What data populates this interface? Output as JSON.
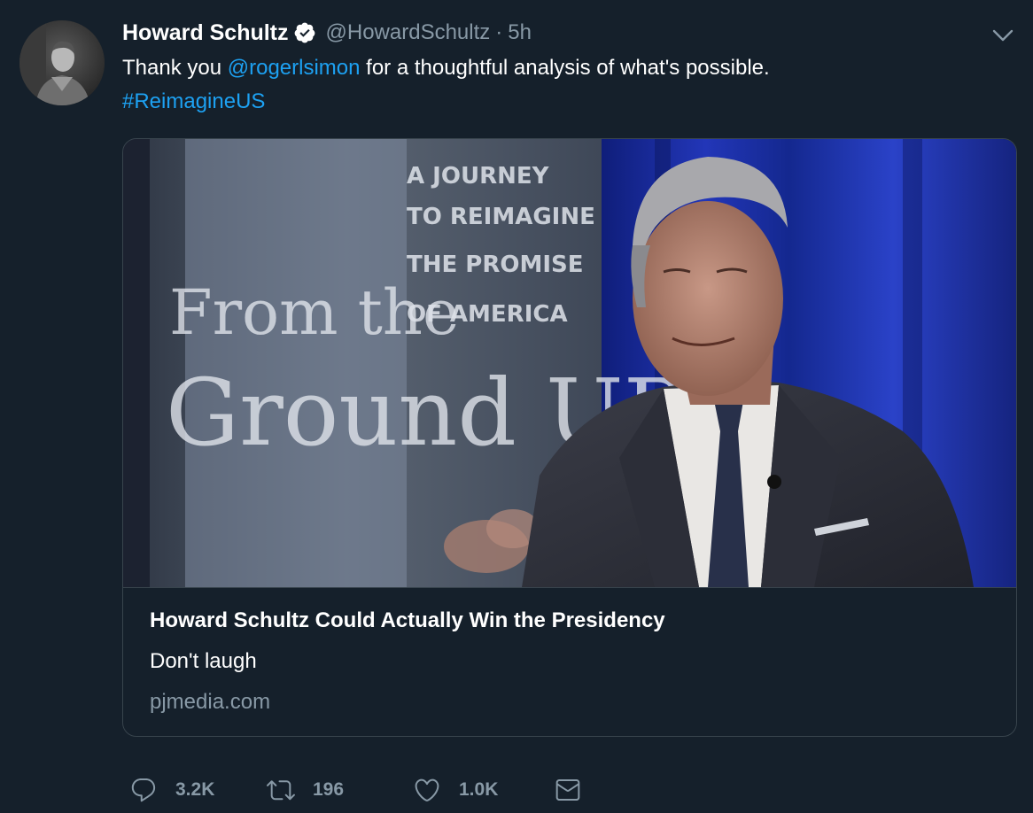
{
  "tweet": {
    "author": {
      "display_name": "Howard Schultz",
      "handle": "@HowardSchultz",
      "verified": true
    },
    "separator": "·",
    "time": "5h",
    "text_prefix": "Thank you ",
    "mention": "@rogerlsimon",
    "text_suffix": " for a thoughtful analysis of what's possible.",
    "hashtag": "#ReimagineUS"
  },
  "card": {
    "image_text": {
      "from_the": "From the",
      "ground_up": "Ground UP",
      "journey_lines": [
        "A JOURNEY",
        "TO REIMAGINE",
        "THE PROMISE",
        "OF AMERICA"
      ]
    },
    "title": "Howard Schultz Could Actually Win the Presidency",
    "description": "Don't laugh",
    "domain": "pjmedia.com"
  },
  "actions": {
    "reply": {
      "icon": "reply-icon",
      "count": "3.2K"
    },
    "retweet": {
      "icon": "retweet-icon",
      "count": "196"
    },
    "like": {
      "icon": "heart-icon",
      "count": "1.0K"
    },
    "dm": {
      "icon": "envelope-icon"
    }
  },
  "colors": {
    "background": "#15202b",
    "link": "#1da1f2",
    "muted": "#8899a6",
    "border": "#38444d"
  }
}
